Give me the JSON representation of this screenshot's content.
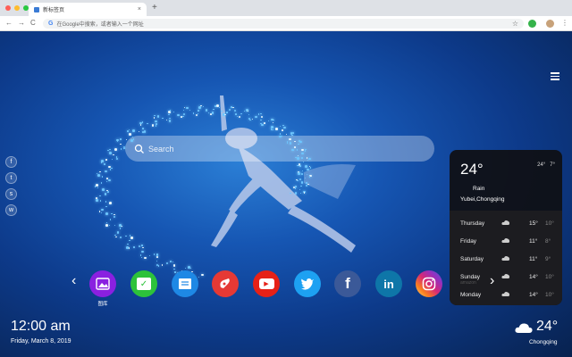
{
  "browser": {
    "tab_title": "新标签页",
    "tab_close": "×",
    "new_tab": "+",
    "back": "←",
    "forward": "→",
    "reload": "C",
    "omnibox_badge": "G",
    "omnibox_placeholder": "在Google中搜索，或者输入一个网址",
    "bookmark": "☆",
    "menu": "⋮"
  },
  "search": {
    "placeholder": "Search"
  },
  "social_links": [
    {
      "icon": "facebook-icon",
      "glyph": "f"
    },
    {
      "icon": "twitter-icon",
      "glyph": "t"
    },
    {
      "icon": "snapchat-icon",
      "glyph": "s"
    },
    {
      "icon": "wechat-icon",
      "glyph": "w"
    }
  ],
  "weather": {
    "current_temp": "24°",
    "high": "24°",
    "low": "7°",
    "condition": "Rain",
    "location": "Yubei,Chongqing",
    "forecast": [
      {
        "day": "Thursday",
        "high": "15°",
        "low": "10°"
      },
      {
        "day": "Friday",
        "high": "11°",
        "low": "8°"
      },
      {
        "day": "Saturday",
        "high": "11°",
        "low": "9°"
      },
      {
        "day": "Sunday",
        "high": "14°",
        "low": "10°"
      },
      {
        "day": "Monday",
        "high": "14°",
        "low": "10°"
      }
    ],
    "footer_text": "amazon",
    "widget_temp": "24°",
    "widget_city": "Chongqing"
  },
  "dock": {
    "prev": "‹",
    "next": "›",
    "apps": [
      {
        "name": "gallery",
        "glyph": "",
        "label": "图库",
        "color": "#8a20e0"
      },
      {
        "name": "tasks",
        "glyph": "✓",
        "label": "",
        "color": "#2dc23a"
      },
      {
        "name": "notes",
        "glyph": "",
        "label": "",
        "color": "#1e88e5"
      },
      {
        "name": "games",
        "glyph": "",
        "label": "",
        "color": "#e53935"
      },
      {
        "name": "youtube",
        "glyph": "▶",
        "label": "",
        "color": "#e62117"
      },
      {
        "name": "twitter",
        "glyph": "",
        "label": "",
        "color": "#1da1f2"
      },
      {
        "name": "facebook",
        "glyph": "f",
        "label": "",
        "color": "#3b5998"
      },
      {
        "name": "linkedin",
        "glyph": "in",
        "label": "",
        "color": "#0e76a8"
      },
      {
        "name": "instagram",
        "glyph": "",
        "label": "",
        "color": "#d62976"
      }
    ]
  },
  "clock": {
    "time": "12:00 am",
    "date": "Friday, March 8, 2019"
  }
}
